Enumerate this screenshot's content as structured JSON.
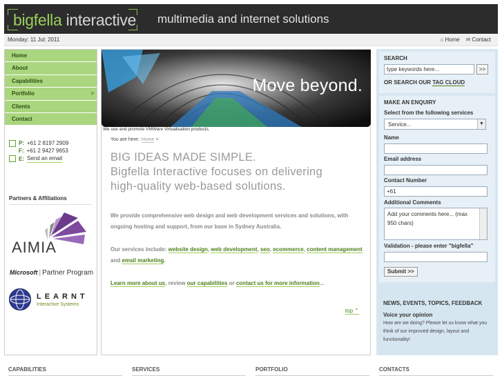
{
  "brand": {
    "logo_big": "bigfella",
    "logo_rest": " interactive",
    "tagline": "multimedia and internet solutions"
  },
  "subbar": {
    "date": "Monday: 11 Jul: 2011",
    "home_link": "Home",
    "contact_link": "Contact"
  },
  "nav": {
    "items": [
      "Home",
      "About",
      "Capabilities",
      "Portfolio",
      "Clients",
      "Contact"
    ],
    "portfolio_chevron": ">"
  },
  "contact": {
    "phone_label": "P:",
    "phone": "+61 2 8197 2909",
    "fax_label": "F:",
    "fax": "+61 2 9427 9653",
    "email_label": "E:",
    "email_link": "Send an email"
  },
  "partners": {
    "title": "Partners & Affiliations",
    "aimia": "AIMIA",
    "microsoft": "Microsoft",
    "partner_program": "Partner Program",
    "learnt": "LEARNT",
    "learnt_sub": "Interactive Systems"
  },
  "hero": {
    "text": "Move beyond.",
    "caption": "We use and promote VMWare Virtualisation products."
  },
  "breadcrumb": {
    "label": "You are here:",
    "home": "Home",
    "arrow": ">"
  },
  "main": {
    "headline_1": "BIG IDEAS MADE SIMPLE.",
    "headline_2": "Bigfella Interactive focuses on delivering",
    "headline_3": "high-quality web-based solutions.",
    "para1": "We provide comprehensive web design and web development services and solutions, with ongoing hosting and support, from our base in Sydney Australia.",
    "services_intro": "Our services include: ",
    "svc_web_design": "website design",
    "svc_web_dev": "web development",
    "svc_seo": "seo",
    "svc_ecommerce": "ecommerce",
    "svc_content": "content management",
    "svc_and": " and ",
    "svc_email": "email marketing",
    "learn_more": "Learn more about us",
    "review": ", review ",
    "capabilities": "our capabilities",
    "or": " or ",
    "contact_us": "contact us for more information",
    "ellipsis": "...",
    "top": "top"
  },
  "search": {
    "title": "SEARCH",
    "placeholder": "type keywords here...",
    "go": ">>",
    "or_search": "OR SEARCH OUR ",
    "tag_cloud": "TAG CLOUD"
  },
  "enquiry": {
    "title": "MAKE AN ENQUIRY",
    "services_label": "Select from the following services",
    "services_value": "Service...",
    "name_label": "Name",
    "email_label": "Email address",
    "phone_label": "Contact Number",
    "phone_value": "+61",
    "comments_label": "Additional Comments",
    "comments_value": "Add your comments here... (max 950 chars)",
    "validation_label": "Validation - please enter \"bigfella\"",
    "submit": "Submit  >>"
  },
  "news": {
    "title": "NEWS, EVENTS, TOPICS, FEEDBACK",
    "voice_title": "Voice your opinion",
    "voice_text": "How are we doing? Please let us know what you think of our improved design, layout and functionality!"
  },
  "footer": {
    "cols": [
      "CAPABILITIES",
      "SERVICES",
      "PORTFOLIO",
      "CONTACTS"
    ]
  },
  "colors": {
    "accent_green": "#a9d67e",
    "link_green": "#4a7e1a",
    "header_dark": "#2c2c2c",
    "sidebar_blue": "#d6e6f0"
  }
}
